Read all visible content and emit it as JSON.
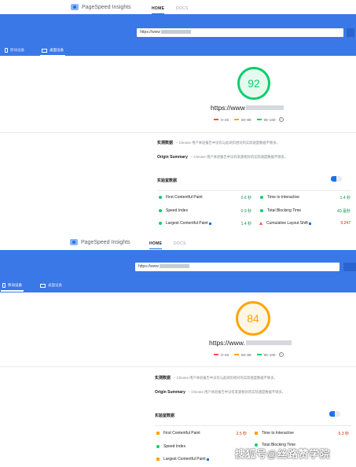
{
  "top": {
    "app_name": "PageSpeed Insights",
    "nav": [
      "HOME",
      "DOCS"
    ],
    "url_prefix": "https://www",
    "tabs": [
      "移动设备",
      "桌面设备"
    ],
    "score": "92",
    "score_color": "#0cce6b",
    "site_url_prefix": "https://www",
    "legend": [
      "0–49",
      "50–89",
      "90–100"
    ],
    "legend_colors": [
      "#ff4e42",
      "#ffa400",
      "#0cce6b"
    ],
    "field_data": {
      "title": "实测数据",
      "desc": " –  Chrome 用户体验报告中没有与此网页相对的实际速度数据不够多。"
    },
    "origin_summary": {
      "title": "Origin Summary",
      "desc": " –  Chrome 用户体验报告中没有来源相对的实际速度数据不够多。"
    },
    "lab_title": "实验室数据",
    "metrics_left": [
      {
        "label": "First Contentful Paint",
        "value": "0.6 秒",
        "status": "green"
      },
      {
        "label": "Speed Index",
        "value": "0.9 秒",
        "status": "green"
      },
      {
        "label": "Largest Contentful Paint",
        "value": "1.4 秒",
        "status": "green"
      }
    ],
    "metrics_right": [
      {
        "label": "Time to Interactive",
        "value": "1.4 秒",
        "status": "green"
      },
      {
        "label": "Total Blocking Time",
        "value": "40 毫秒",
        "status": "green"
      },
      {
        "label": "Cumulative Layout Shift",
        "value": "0.247",
        "status": "red"
      }
    ]
  },
  "bottom": {
    "app_name": "PageSpeed Insights",
    "nav": [
      "HOME",
      "DOCS"
    ],
    "url_prefix": "https://www",
    "tabs": [
      "移动设备",
      "桌面设备"
    ],
    "score": "84",
    "score_color": "#ffa400",
    "site_url_prefix": "https://www.",
    "legend": [
      "0–49",
      "50–89",
      "90–100"
    ],
    "legend_colors": [
      "#ff4e42",
      "#ffa400",
      "#0cce6b"
    ],
    "field_data": {
      "title": "实测数据",
      "desc": " –  Chrome 用户体验报告中没有与此网页相对的实际速度数据不够多。"
    },
    "origin_summary": {
      "title": "Origin Summary",
      "desc": " –  Chrome 用户体验报告中没有来源相对的实际速度数据不够多。"
    },
    "lab_title": "实验室数据",
    "metrics_left": [
      {
        "label": "First Contentful Paint",
        "value": "2.5 秒",
        "status": "orange"
      },
      {
        "label": "Speed Index",
        "value": "",
        "status": "green"
      },
      {
        "label": "Largest Contentful Paint",
        "value": "",
        "status": "orange"
      }
    ],
    "metrics_right": [
      {
        "label": "Time to Interactive",
        "value": "5.3 秒",
        "status": "orange"
      },
      {
        "label": "Total Blocking Time",
        "value": "",
        "status": "green"
      }
    ]
  },
  "watermark": "搜狐号@丝路赞学院"
}
